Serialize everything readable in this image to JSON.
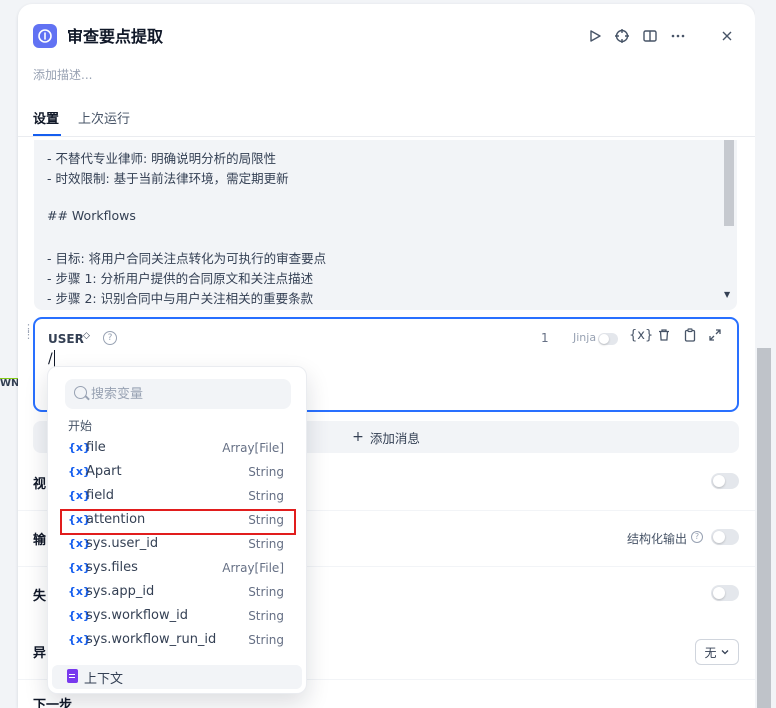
{
  "edge": {
    "label": "WN"
  },
  "header": {
    "title": "审查要点提取",
    "description_placeholder": "添加描述..."
  },
  "tabs": [
    {
      "label": "设置"
    },
    {
      "label": "上次运行"
    }
  ],
  "system_prompt": {
    "lines": [
      "- 不替代专业律师: 明确说明分析的局限性",
      "- 时效限制: 基于当前法律环境，需定期更新",
      "",
      "## Workflows",
      "",
      "- 目标: 将用户合同关注点转化为可执行的审查要点",
      "- 步骤 1: 分析用户提供的合同原文和关注点描述",
      "- 步骤 2: 识别合同中与用户关注相关的重要条款"
    ]
  },
  "user_message": {
    "role": "USER",
    "count": "1",
    "jinja_label": "Jinja",
    "content": "/"
  },
  "add_message_label": "添加消息",
  "rows": {
    "vision_label": "视",
    "output_label": "输",
    "structured_output_label": "结构化输出",
    "fail_label": "失",
    "exception_label": "异",
    "exception_value": "无",
    "next_label": "下一步"
  },
  "variable_picker": {
    "search_placeholder": "搜索变量",
    "section_label": "开始",
    "variables": [
      {
        "name": "file",
        "type": "Array[File]"
      },
      {
        "name": "Apart",
        "type": "String"
      },
      {
        "name": "field",
        "type": "String"
      },
      {
        "name": "attention",
        "type": "String"
      },
      {
        "name": "sys.user_id",
        "type": "String"
      },
      {
        "name": "sys.files",
        "type": "Array[File]"
      },
      {
        "name": "sys.app_id",
        "type": "String"
      },
      {
        "name": "sys.workflow_id",
        "type": "String"
      },
      {
        "name": "sys.workflow_run_id",
        "type": "String"
      }
    ],
    "context_label": "上下文"
  },
  "colors": {
    "accent": "#155eef",
    "node_icon": "#6172f3",
    "highlight": "#e11d1d",
    "context_icon": "#7839ee"
  }
}
